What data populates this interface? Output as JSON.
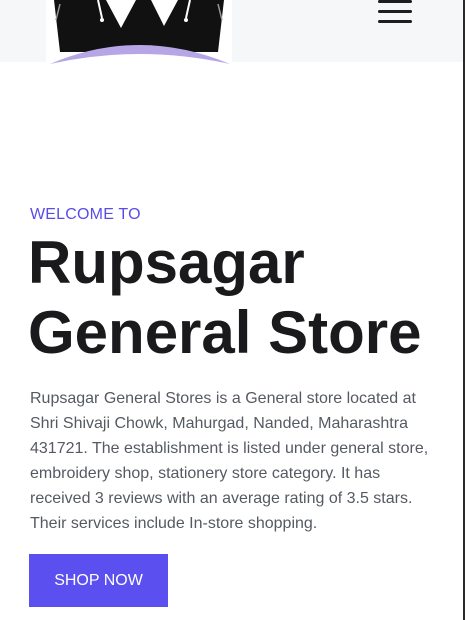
{
  "header": {
    "logo_icon": "shopping-bags-logo-icon",
    "menu_icon": "hamburger-menu-icon"
  },
  "hero": {
    "eyebrow": "WELCOME TO",
    "title": "Rupsagar General Store",
    "description": "Rupsagar General Stores is a General store located at Shri Shivaji Chowk, Mahurgad, Nanded, Maharashtra 431721. The establishment is listed under general store, embroidery shop, stationery store category. It has received 3 reviews with an average rating of 3.5 stars. Their services include In-store shopping.",
    "cta_label": "SHOP NOW"
  },
  "colors": {
    "accent": "#5b4fef",
    "eyebrow": "#5a4ce8",
    "header_bg": "#f6f7f9",
    "logo_arc": "#b7a6e6"
  }
}
